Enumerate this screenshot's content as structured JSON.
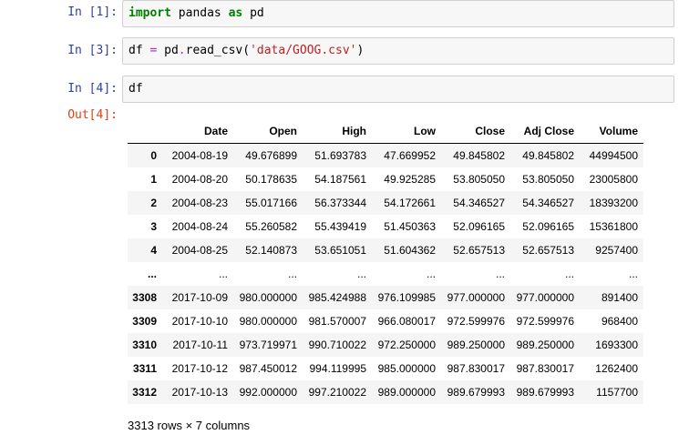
{
  "cells": [
    {
      "prompt": "In [1]:",
      "code": [
        {
          "t": "import",
          "c": "kw"
        },
        {
          "t": " pandas ",
          "c": "tok"
        },
        {
          "t": "as",
          "c": "kw"
        },
        {
          "t": " pd",
          "c": "tok"
        }
      ]
    },
    {
      "prompt": "In [3]:",
      "code": [
        {
          "t": "df ",
          "c": "tok"
        },
        {
          "t": "=",
          "c": "op"
        },
        {
          "t": " pd",
          "c": "tok"
        },
        {
          "t": ".",
          "c": "op"
        },
        {
          "t": "read_csv(",
          "c": "tok"
        },
        {
          "t": "'data/GOOG.csv'",
          "c": "str"
        },
        {
          "t": ")",
          "c": "tok"
        }
      ]
    },
    {
      "prompt": "In [4]:",
      "code": [
        {
          "t": "df",
          "c": "tok"
        }
      ]
    }
  ],
  "output_prompt": "Out[4]:",
  "table": {
    "columns": [
      "",
      "Date",
      "Open",
      "High",
      "Low",
      "Close",
      "Adj Close",
      "Volume"
    ],
    "rows": [
      [
        "0",
        "2004-08-19",
        "49.676899",
        "51.693783",
        "47.669952",
        "49.845802",
        "49.845802",
        "44994500"
      ],
      [
        "1",
        "2004-08-20",
        "50.178635",
        "54.187561",
        "49.925285",
        "53.805050",
        "53.805050",
        "23005800"
      ],
      [
        "2",
        "2004-08-23",
        "55.017166",
        "56.373344",
        "54.172661",
        "54.346527",
        "54.346527",
        "18393200"
      ],
      [
        "3",
        "2004-08-24",
        "55.260582",
        "55.439419",
        "51.450363",
        "52.096165",
        "52.096165",
        "15361800"
      ],
      [
        "4",
        "2004-08-25",
        "52.140873",
        "53.651051",
        "51.604362",
        "52.657513",
        "52.657513",
        "9257400"
      ],
      [
        "...",
        "...",
        "...",
        "...",
        "...",
        "...",
        "...",
        "..."
      ],
      [
        "3308",
        "2017-10-09",
        "980.000000",
        "985.424988",
        "976.109985",
        "977.000000",
        "977.000000",
        "891400"
      ],
      [
        "3309",
        "2017-10-10",
        "980.000000",
        "981.570007",
        "966.080017",
        "972.599976",
        "972.599976",
        "968400"
      ],
      [
        "3310",
        "2017-10-11",
        "973.719971",
        "990.710022",
        "972.250000",
        "989.250000",
        "989.250000",
        "1693300"
      ],
      [
        "3311",
        "2017-10-12",
        "987.450012",
        "994.119995",
        "985.000000",
        "987.830017",
        "987.830017",
        "1262400"
      ],
      [
        "3312",
        "2017-10-13",
        "992.000000",
        "997.210022",
        "989.000000",
        "989.679993",
        "989.679993",
        "1157700"
      ]
    ]
  },
  "summary": "3313 rows × 7 columns"
}
